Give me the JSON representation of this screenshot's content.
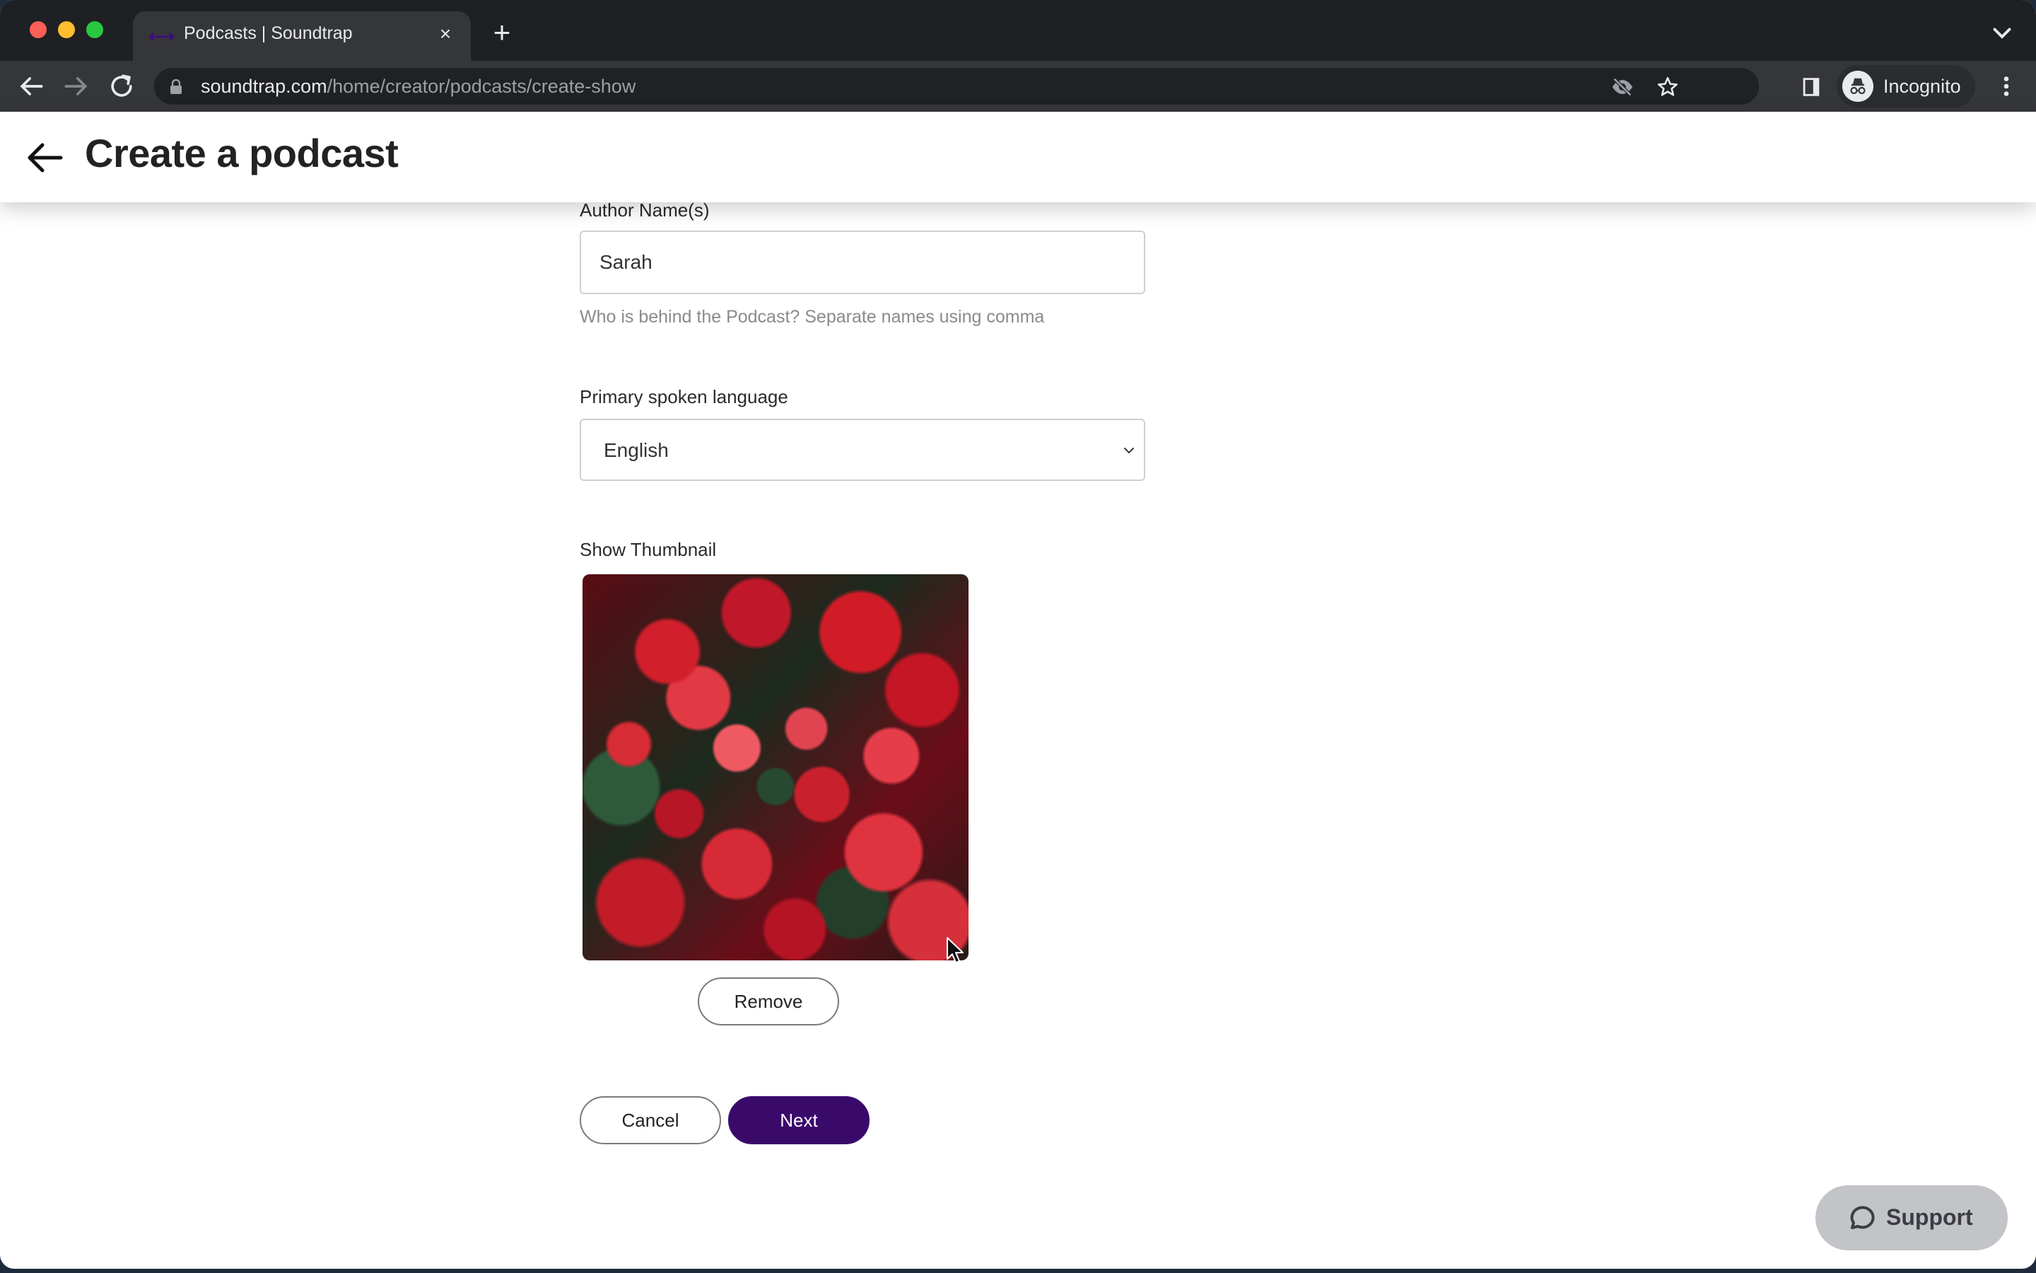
{
  "browser": {
    "tab_title": "Podcasts | Soundtrap",
    "tab_favicon": "soundtrap-logo-icon",
    "new_tab_symbol": "+",
    "close_symbol": "×",
    "url_host": "soundtrap.com",
    "url_path": "/home/creator/podcasts/create-show",
    "profile_label": "Incognito"
  },
  "header": {
    "title": "Create a podcast"
  },
  "form": {
    "author": {
      "label": "Author Name(s)",
      "value": "Sarah",
      "help": "Who is behind the Podcast? Separate names using comma"
    },
    "language": {
      "label": "Primary spoken language",
      "selected": "English"
    },
    "thumbnail": {
      "label": "Show Thumbnail",
      "image_description": "Red begonia flowers with green leaves",
      "remove_label": "Remove"
    },
    "actions": {
      "cancel_label": "Cancel",
      "next_label": "Next"
    }
  },
  "support": {
    "label": "Support"
  },
  "colors": {
    "primary": "#3a0a6b",
    "support_bg": "#c3c4c8",
    "help_text": "#8a8a8a"
  }
}
